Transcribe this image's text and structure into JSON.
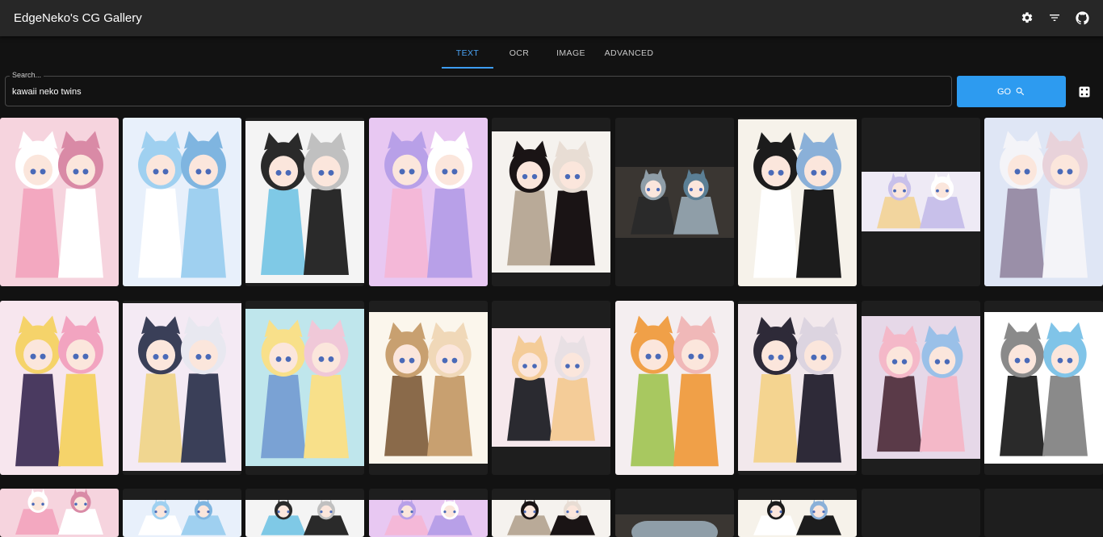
{
  "app": {
    "title": "EdgeNeko's CG Gallery"
  },
  "toolbar_icons": [
    "settings-icon",
    "filter-icon",
    "github-icon"
  ],
  "tabs": [
    {
      "label": "TEXT",
      "active": true
    },
    {
      "label": "OCR",
      "active": false
    },
    {
      "label": "IMAGE",
      "active": false
    },
    {
      "label": "ADVANCED",
      "active": false
    }
  ],
  "search": {
    "label": "Search...",
    "value": "kawaii neko twins"
  },
  "go_button": {
    "label": "GO",
    "icon": "search-icon"
  },
  "random_button": {
    "icon": "dice-icon"
  },
  "colors": {
    "appbar": "#272727",
    "background": "#121212",
    "accent": "#2d9bf0",
    "tab_active": "#4aa3f5",
    "cell": "#1e1e1e"
  },
  "results": [
    {
      "palette": [
        "#f6d4de",
        "#ffffff",
        "#f3a8c0",
        "#d98aa6"
      ]
    },
    {
      "palette": [
        "#e8f0fb",
        "#9fd0f0",
        "#ffffff",
        "#7fb5e0"
      ]
    },
    {
      "palette": [
        "#f4f4f4",
        "#2a2a2a",
        "#7fc9e6",
        "#c0c0c0"
      ]
    },
    {
      "palette": [
        "#e8c8f2",
        "#b8a0e8",
        "#f4b8d8",
        "#ffffff"
      ]
    },
    {
      "palette": [
        "#f5f2ee",
        "#1a1415",
        "#b9aa98",
        "#e8ddd4"
      ]
    },
    {
      "palette": [
        "#3a3632",
        "#8f9ea8",
        "#2a2a2a",
        "#5b7f95"
      ]
    },
    {
      "palette": [
        "#f6f2ea",
        "#1c1c1c",
        "#ffffff",
        "#8ab0d8"
      ]
    },
    {
      "palette": [
        "#eeeaf5",
        "#c8c0ea",
        "#f2d59e",
        "#ffffff"
      ]
    },
    {
      "palette": [
        "#dfe6f5",
        "#f4f4f8",
        "#9a8fa8",
        "#e8d2da"
      ]
    },
    {
      "palette": [
        "#f7e6ee",
        "#f5d36a",
        "#4a3a60",
        "#f2a4c0"
      ]
    },
    {
      "palette": [
        "#f4eaf4",
        "#3a3f58",
        "#f0d690",
        "#e8e8f0"
      ]
    },
    {
      "palette": [
        "#bfe6ec",
        "#f8e08a",
        "#7aa2d4",
        "#f0c8d8"
      ]
    },
    {
      "palette": [
        "#fbf6ec",
        "#c8a070",
        "#8a6a4a",
        "#f0d8b8"
      ]
    },
    {
      "palette": [
        "#f6e8ec",
        "#f4cc98",
        "#2a2a30",
        "#e8e0e4"
      ]
    },
    {
      "palette": [
        "#f4eef0",
        "#f0a048",
        "#a8c860",
        "#f0b8b8"
      ]
    },
    {
      "palette": [
        "#f2e8ec",
        "#2e2a38",
        "#f4d490",
        "#dcd4e0"
      ]
    },
    {
      "palette": [
        "#e6d8e8",
        "#f4b8c8",
        "#5a3a48",
        "#9ac0e8"
      ]
    },
    {
      "palette": [
        "#ffffff",
        "#8a8a8a",
        "#2a2a2a",
        "#80c4e8"
      ]
    }
  ]
}
